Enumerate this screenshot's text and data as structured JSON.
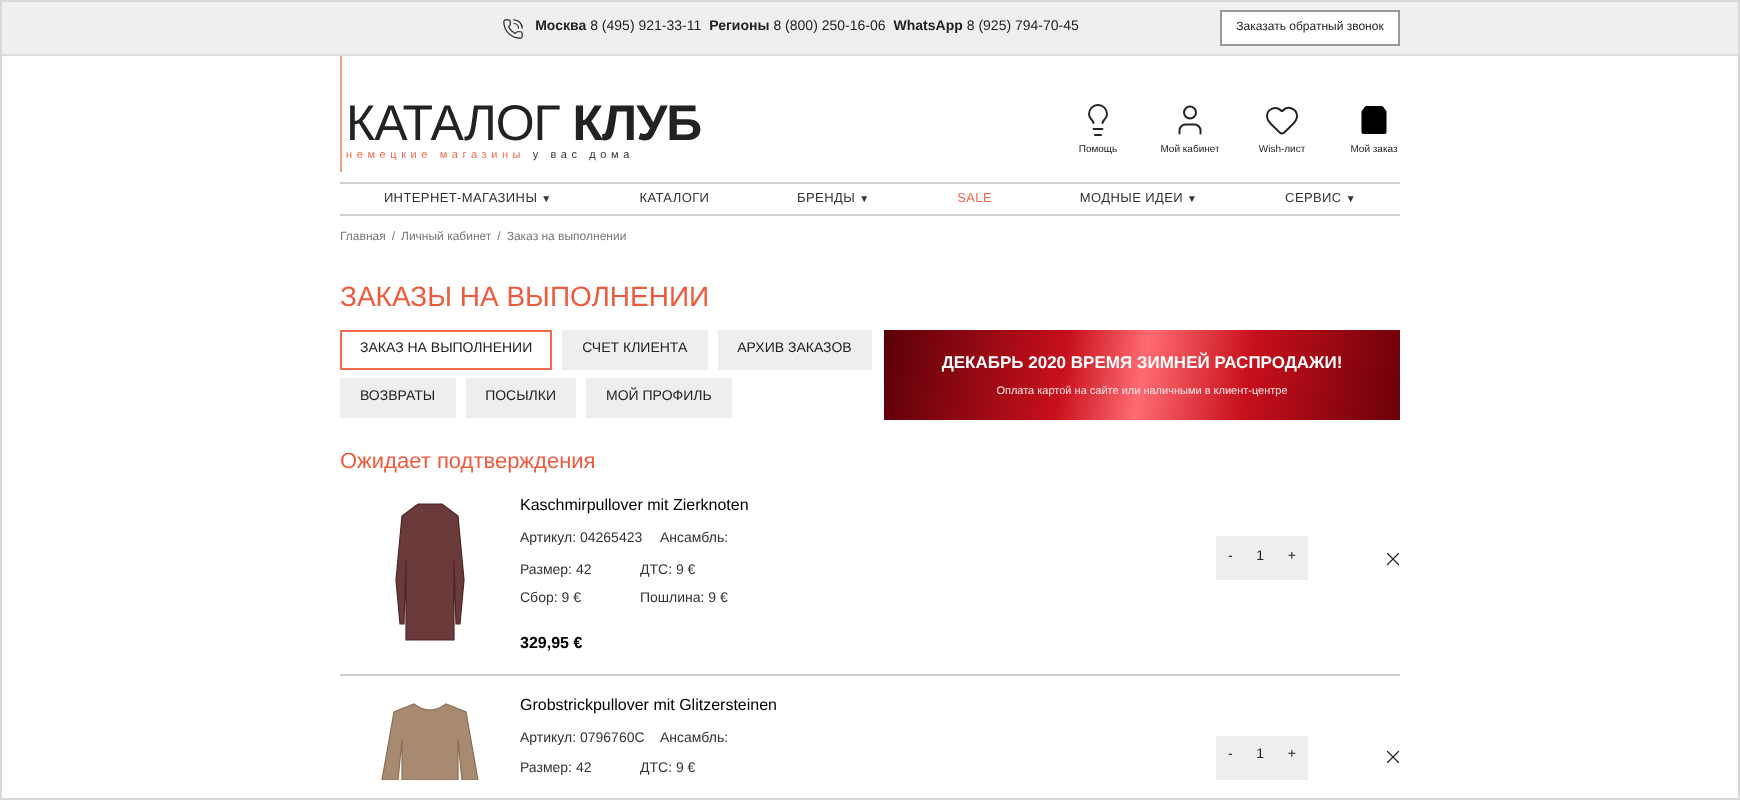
{
  "top_bar": {
    "phones": [
      {
        "label": "Москва",
        "number": "8 (495) 921-33-11"
      },
      {
        "label": "Регионы",
        "number": "8 (800) 250-16-06"
      },
      {
        "label": "WhatsApp",
        "number": "8 (925) 794-70-45"
      }
    ],
    "callback_button": "Заказать обратный звонок"
  },
  "logo": {
    "word_1": "КАТАЛОГ",
    "word_2": "КЛУБ",
    "tagline_1": "немецкие магазины",
    "tagline_2": "у вас дома"
  },
  "header_links": [
    {
      "kind": "help",
      "label": "Помощь"
    },
    {
      "kind": "account",
      "label": "Мой кабинет"
    },
    {
      "kind": "wishlist",
      "label": "Wish-лист"
    },
    {
      "kind": "cart",
      "label": "Мой заказ"
    }
  ],
  "nav": [
    {
      "label": "ИНТЕРНЕТ-МАГАЗИНЫ",
      "caret": "▼",
      "highlighted": false
    },
    {
      "label": "КАТАЛОГИ",
      "highlighted": false
    },
    {
      "label": "БРЕНДЫ",
      "caret": "▼",
      "highlighted": false
    },
    {
      "label": "SALE",
      "highlighted": true
    },
    {
      "label": "МОДНЫЕ ИДЕИ",
      "caret": "▼",
      "highlighted": false
    },
    {
      "label": "СЕРВИС",
      "caret": "▼",
      "highlighted": false
    }
  ],
  "breadcrumbs": [
    {
      "label": "Главная"
    },
    {
      "separator": "/",
      "label": "Личный кабинет"
    },
    {
      "separator": "/",
      "label": "Заказ на выполнении"
    }
  ],
  "page_title": "ЗАКАЗЫ НА ВЫПОЛНЕНИИ",
  "tabs": [
    [
      {
        "label": "ЗАКАЗ НА ВЫПОЛНЕНИИ",
        "selected": true
      },
      {
        "label": "СЧЕТ КЛИЕНТА",
        "selected": false
      },
      {
        "label": "АРХИВ ЗАКАЗОВ",
        "selected": false
      }
    ],
    [
      {
        "label": "ВОЗВРАТЫ",
        "selected": false
      },
      {
        "label": "ПОСЫЛКИ",
        "selected": false
      },
      {
        "label": "МОЙ ПРОФИЛЬ",
        "selected": false
      }
    ]
  ],
  "banner": {
    "title": "ДЕКАБРЬ 2020 ВРЕМЯ ЗИМНЕЙ РАСПРОДАЖИ!",
    "subtitle": "Оплата картой на сайте или наличными в клиент-центре"
  },
  "section_title": "Ожидает подтверждения",
  "items": [
    {
      "kind": "coat",
      "name": "Kaschmirpullover mit Zierknoten",
      "article": "Артикул: 04265423",
      "ensemble": "Ансамбль:",
      "size": "Размер: 42",
      "dtc": "ДТС: 9 €",
      "fee": "Сбор: 9 €",
      "duty": "Пошлина: 9 €",
      "price": "329,95 €",
      "minus": "-",
      "quantity": "1",
      "plus": "+"
    },
    {
      "kind": "sweater",
      "name": "Grobstrickpullover mit Glitzersteinen",
      "article": "Артикул: 0796760C",
      "ensemble": "Ансамбль:",
      "size": "Размер: 42",
      "dtc": "ДТС: 9 €",
      "minus": "-",
      "quantity": "1",
      "plus": "+"
    }
  ]
}
